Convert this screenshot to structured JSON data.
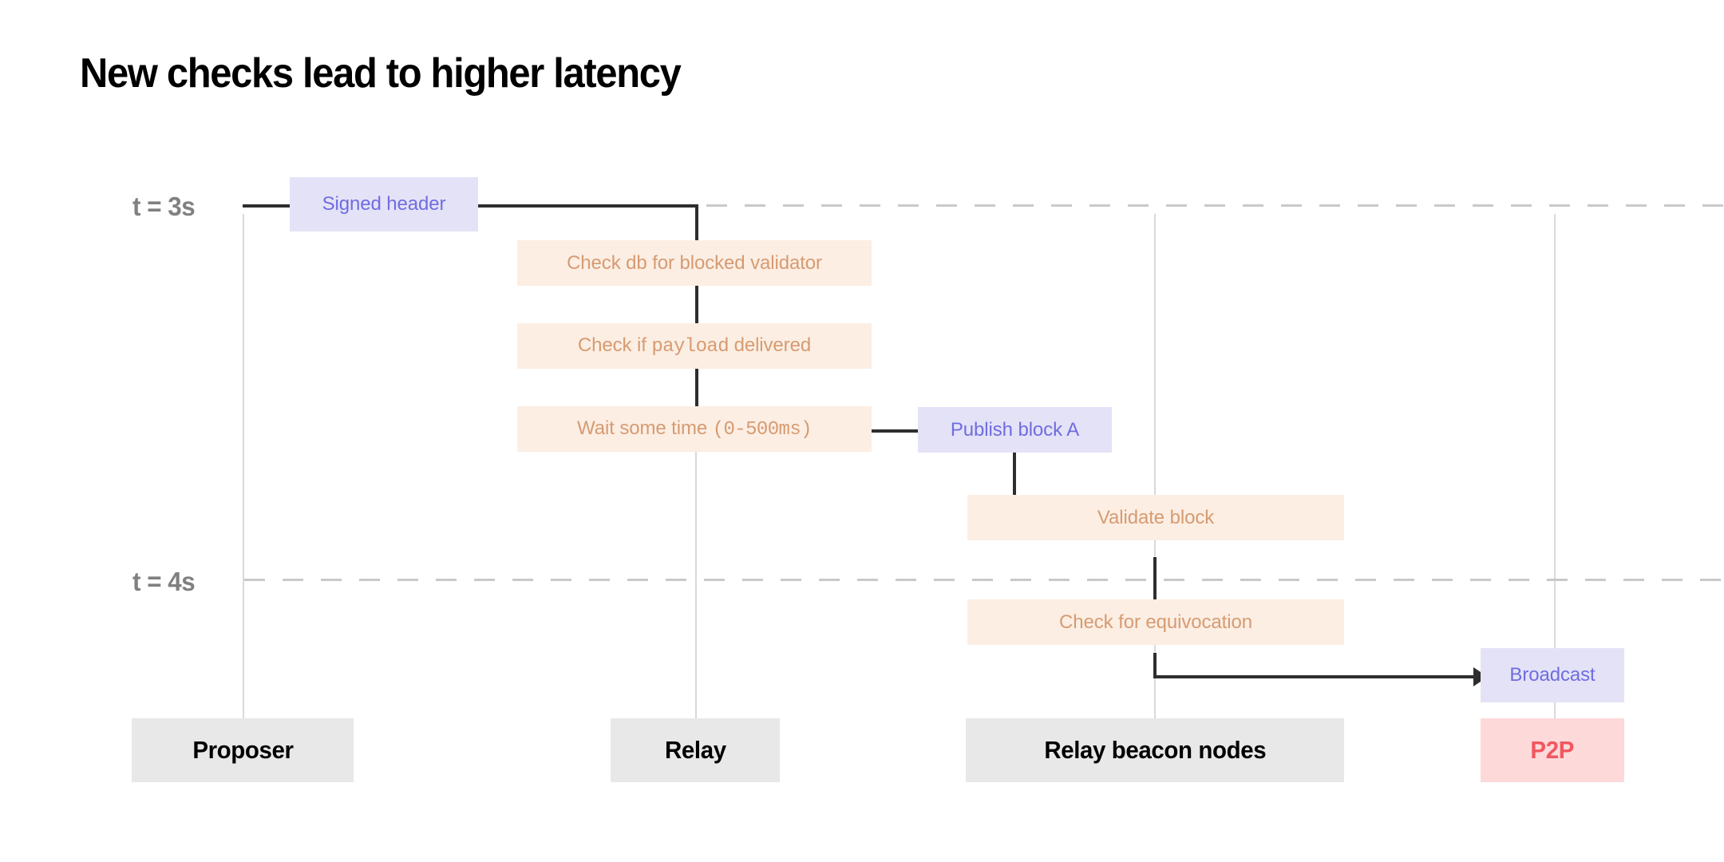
{
  "title": "New checks lead to higher latency",
  "time_rules": [
    {
      "label": "t = 3s"
    },
    {
      "label": "t = 4s"
    }
  ],
  "lanes": [
    {
      "label": "Proposer",
      "kind": "neutral"
    },
    {
      "label": "Relay",
      "kind": "neutral"
    },
    {
      "label": "Relay beacon nodes",
      "kind": "neutral"
    },
    {
      "label": "P2P",
      "kind": "p2p"
    }
  ],
  "events": {
    "signed_header": {
      "label": "Signed header",
      "kind": "purple"
    },
    "check_db": {
      "label": "Check db for blocked validator",
      "kind": "orange"
    },
    "check_payload": {
      "kind": "orange",
      "parts": [
        {
          "text": "Check if ",
          "mono": false
        },
        {
          "text": "payload",
          "mono": true
        },
        {
          "text": " delivered",
          "mono": false
        }
      ]
    },
    "wait_some_time": {
      "kind": "orange",
      "parts": [
        {
          "text": "Wait some time ",
          "mono": false
        },
        {
          "text": "(0-500ms)",
          "mono": true
        }
      ]
    },
    "publish_block": {
      "label": "Publish block A",
      "kind": "purple"
    },
    "validate_block": {
      "label": "Validate block",
      "kind": "orange"
    },
    "check_equivocation": {
      "label": "Check for equivocation",
      "kind": "orange"
    },
    "broadcast": {
      "label": "Broadcast",
      "kind": "purple"
    }
  },
  "colors": {
    "orange_bg": "#fceee3",
    "orange_text": "#d69b72",
    "purple_bg": "#e4e2f7",
    "purple_text": "#6f6de0",
    "lane_bg": "#e8e8e8",
    "p2p_bg": "#fdd9da",
    "p2p_text": "#f2575f",
    "connector": "#2e2e2e",
    "rule": "#c9c9c9",
    "lane_line": "#d9d9d9",
    "time_label": "#808080",
    "title": "#000000"
  }
}
